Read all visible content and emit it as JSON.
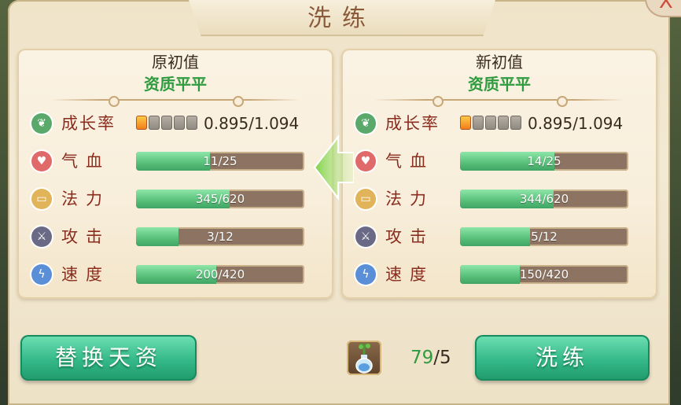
{
  "title": "洗练",
  "close_label": "X",
  "cards": {
    "original": {
      "title": "原初值",
      "quality": "资质平平",
      "growth": {
        "label": "成长率",
        "value": "0.895/1.094",
        "lit_pips": 1,
        "total_pips": 5
      },
      "stats": [
        {
          "label": "气血",
          "text": "11/25",
          "current": 11,
          "max": 25
        },
        {
          "label": "法力",
          "text": "345/620",
          "current": 345,
          "max": 620
        },
        {
          "label": "攻击",
          "text": "3/12",
          "current": 3,
          "max": 12
        },
        {
          "label": "速度",
          "text": "200/420",
          "current": 200,
          "max": 420
        }
      ]
    },
    "new": {
      "title": "新初值",
      "quality": "资质平平",
      "growth": {
        "label": "成长率",
        "value": "0.895/1.094",
        "lit_pips": 1,
        "total_pips": 5
      },
      "stats": [
        {
          "label": "气血",
          "text": "14/25",
          "current": 14,
          "max": 25
        },
        {
          "label": "法力",
          "text": "344/620",
          "current": 344,
          "max": 620
        },
        {
          "label": "攻击",
          "text": "5/12",
          "current": 5,
          "max": 12
        },
        {
          "label": "速度",
          "text": "150/420",
          "current": 150,
          "max": 420
        }
      ]
    }
  },
  "icons": {
    "growth": "sprout-icon",
    "hp": "heart-icon",
    "mp": "scroll-icon",
    "attack": "sword-icon",
    "speed": "lightning-icon",
    "item": "potion-icon",
    "arrow": "arrow-left-icon"
  },
  "buttons": {
    "replace": "替换天资",
    "refine": "洗练"
  },
  "item": {
    "have": "79",
    "sep_need": "/5"
  },
  "colors": {
    "accent_green": "#2f9b3f",
    "label_red": "#8a2c1e",
    "bar_track": "#8d7361",
    "button_green": "#35b98a"
  }
}
